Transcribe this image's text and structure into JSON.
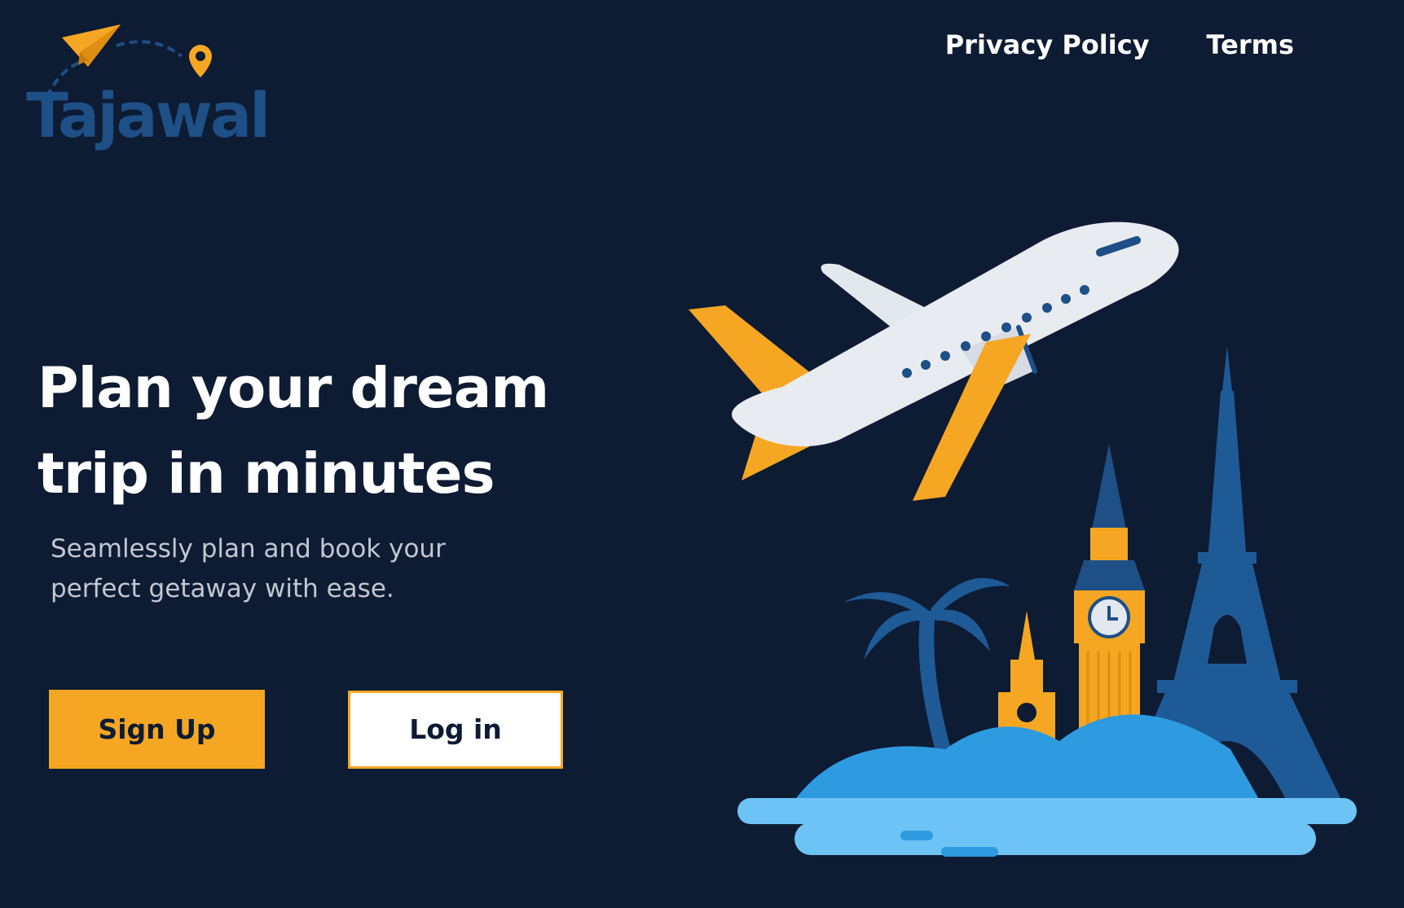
{
  "brand": {
    "logo_text": "Tajawal",
    "colors": {
      "background": "#0d1b33",
      "accent": "#f5a623",
      "brand_blue": "#1e4f86",
      "text_primary": "#ffffff",
      "text_secondary": "#c2c7d0"
    }
  },
  "nav": {
    "privacy_label": "Privacy Policy",
    "terms_label": "Terms"
  },
  "hero": {
    "headline_line1": "Plan your dream",
    "headline_line2": "trip in minutes",
    "subtext_line1": "Seamlessly plan and book your",
    "subtext_line2": "perfect getaway with ease."
  },
  "actions": {
    "signup_label": "Sign Up",
    "login_label": "Log in"
  },
  "illustration": {
    "icons": [
      "airplane-icon",
      "palm-tree-icon",
      "big-ben-icon",
      "eiffel-tower-icon",
      "tower-icon",
      "island-icon"
    ]
  }
}
